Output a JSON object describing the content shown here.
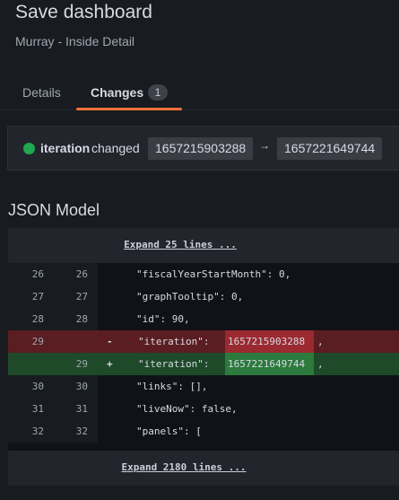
{
  "header": {
    "title": "Save dashboard",
    "subtitle": "Murray - Inside Detail"
  },
  "tabs": [
    {
      "label": "Details",
      "active": false
    },
    {
      "label": "Changes",
      "active": true,
      "count": "1"
    }
  ],
  "change_summary": {
    "key": "iteration",
    "verb": "changed",
    "old_value": "1657215903288",
    "arrow": "→",
    "new_value": "1657221649744",
    "status_color": "#1fa84f"
  },
  "json_model": {
    "title": "JSON Model",
    "expand_top_label": "Expand 25 lines ...",
    "expand_bottom_label": "Expand 2180 lines ...",
    "lines": [
      {
        "old_ln": "26",
        "new_ln": "26",
        "code": "\"fiscalYearStartMonth\": 0,"
      },
      {
        "old_ln": "27",
        "new_ln": "27",
        "code": "\"graphTooltip\": 0,"
      },
      {
        "old_ln": "28",
        "new_ln": "28",
        "code": "\"id\": 90,"
      },
      {
        "old_ln": "29",
        "new_ln": "",
        "marker": "-",
        "code": "\"iteration\": ",
        "value": "1657215903288",
        "trail": ","
      },
      {
        "old_ln": "",
        "new_ln": "29",
        "marker": "+",
        "code": "\"iteration\": ",
        "value": "1657221649744",
        "trail": ","
      },
      {
        "old_ln": "30",
        "new_ln": "30",
        "code": "\"links\": [],"
      },
      {
        "old_ln": "31",
        "new_ln": "31",
        "code": "\"liveNow\": false,"
      },
      {
        "old_ln": "32",
        "new_ln": "32",
        "code": "\"panels\": ["
      }
    ]
  }
}
